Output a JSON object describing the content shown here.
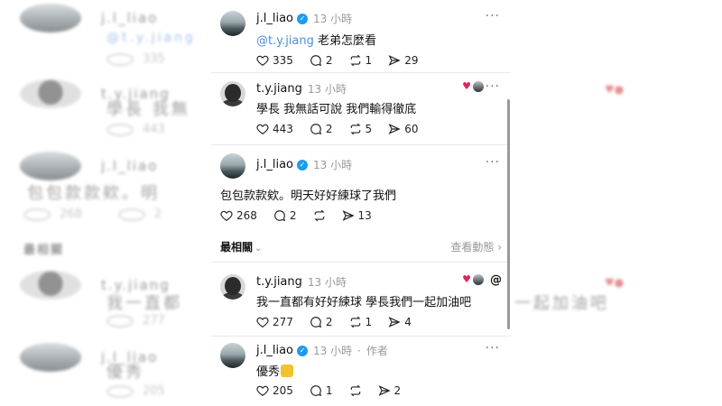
{
  "background": {
    "rows": [
      {
        "name": "j.l_liao",
        "text": "@t.y.jiang",
        "stat": "335"
      },
      {
        "name": "t.y.jiang",
        "text": "學長 我無",
        "stat": "443"
      },
      {
        "name": "j.l_liao",
        "text": "包包款款欸。明",
        "stat": "268",
        "stat2": "2"
      },
      {
        "name": "t.y.jiang",
        "text": "我一直都",
        "stat": "277"
      },
      {
        "name": "j.l_liao",
        "text": "優秀",
        "stat": "205"
      }
    ],
    "heading": "最相關",
    "right_text": "一起加油吧"
  },
  "posts": [
    {
      "username": "j.l_liao",
      "time": "13 小時",
      "mention": "@t.y.jiang",
      "text": " 老弟怎麼看",
      "likes": "335",
      "replies": "2",
      "reposts": "1",
      "shares": "29"
    },
    {
      "username": "t.y.jiang",
      "time": "13 小時",
      "text": "學長 我無話可說 我們輸得徹底",
      "likes": "443",
      "replies": "2",
      "reposts": "5",
      "shares": "60"
    },
    {
      "username": "j.l_liao",
      "time": "13 小時",
      "text": "包包款款欸。明天好好練球了我們",
      "likes": "268",
      "replies": "2",
      "shares": "13"
    },
    {
      "username": "t.y.jiang",
      "time": "13 小時",
      "text": "我一直都有好好練球 學長我們一起加油吧",
      "likes": "277",
      "replies": "2",
      "reposts": "1",
      "shares": "4"
    },
    {
      "username": "j.l_liao",
      "time": "13 小時",
      "author_tag": "作者",
      "text": "優秀",
      "likes": "205",
      "replies": "1",
      "shares": "2"
    }
  ],
  "section": {
    "title": "最相關",
    "link": "查看動態"
  },
  "icons": {
    "like": "heart-icon",
    "reply": "comment-icon",
    "repost": "repost-icon",
    "share": "send-icon",
    "verified": "verified-badge-icon",
    "threads": "threads-logo-icon"
  },
  "colors": {
    "mention": "#4d8fd6",
    "verified": "#1d9bf0",
    "heart": "#e0245e"
  }
}
